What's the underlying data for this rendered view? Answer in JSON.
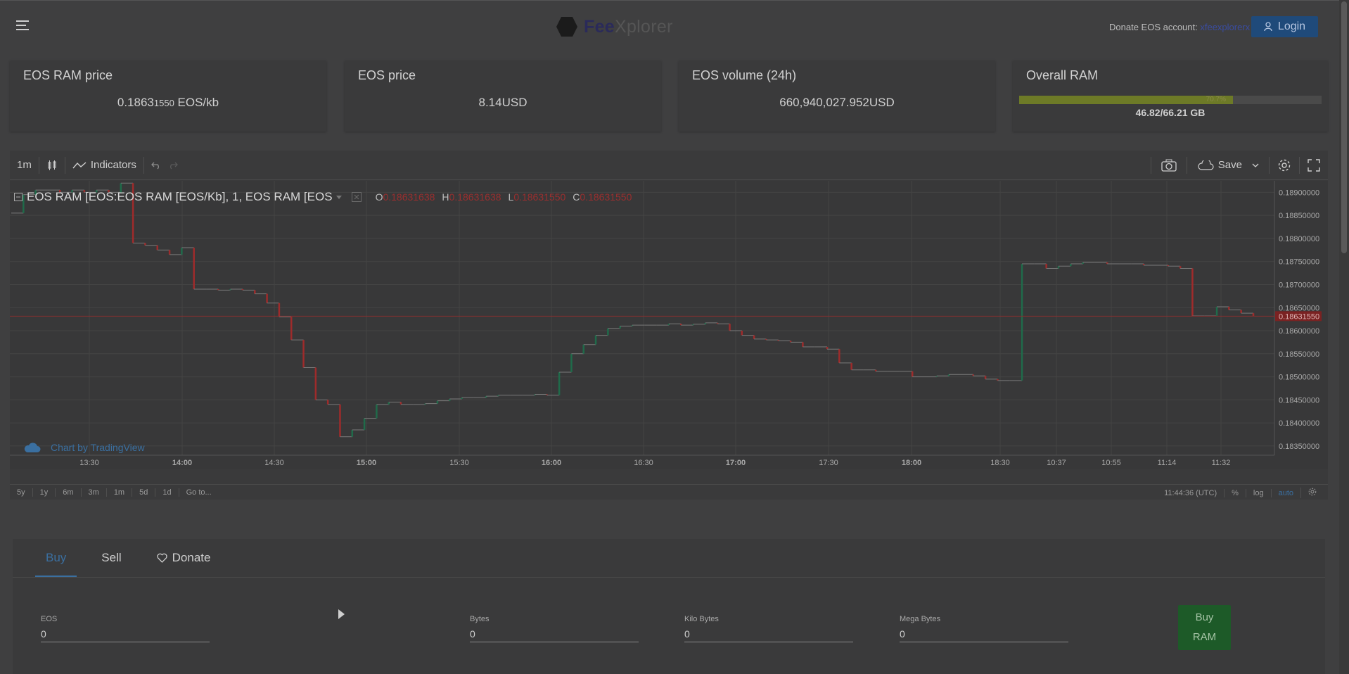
{
  "header": {
    "logo_fee": "Fee",
    "logo_xplorer": "Xplorer",
    "donate_prefix": "Donate EOS account: ",
    "donate_account": "xfeexplorerx",
    "login_label": "Login"
  },
  "stats": {
    "ram_price": {
      "title": "EOS RAM price",
      "value_main": "0.1863",
      "value_small": "1550",
      "unit": " EOS/kb"
    },
    "eos_price": {
      "title": "EOS price",
      "value": "8.14USD"
    },
    "eos_volume": {
      "title": "EOS volume (24h)",
      "value": "660,940,027.952USD"
    },
    "overall_ram": {
      "title": "Overall RAM",
      "percent_label": "70.7%",
      "fill_percent": 70.7,
      "value": "46.82/66.21 GB"
    }
  },
  "chart_toolbar": {
    "interval": "1m",
    "indicators": "Indicators",
    "save": "Save"
  },
  "chart_legend": {
    "symbol": "EOS RAM [EOS:EOS RAM [EOS/Kb], 1, EOS RAM [EOS",
    "o_label": "O",
    "o_value": "0.18631638",
    "h_label": "H",
    "h_value": "0.18631638",
    "l_label": "L",
    "l_value": "0.18631550",
    "c_label": "C",
    "c_value": "0.18631550"
  },
  "tradingview_credit": "Chart by TradingView",
  "range_bar": {
    "ranges": [
      "5y",
      "1y",
      "6m",
      "3m",
      "1m",
      "5d",
      "1d",
      "Go to..."
    ],
    "time": "11:44:36 (UTC)",
    "percent": "%",
    "log": "log",
    "auto": "auto"
  },
  "chart_data": {
    "type": "line",
    "x_ticks": [
      "13:30",
      "14:00",
      "14:30",
      "15:00",
      "15:30",
      "16:00",
      "16:30",
      "17:00",
      "17:30",
      "18:00",
      "18:30",
      "10:37",
      "10:55",
      "11:14",
      "11:32"
    ],
    "bold_ticks": [
      "14:00",
      "15:00",
      "16:00",
      "17:00",
      "18:00"
    ],
    "y_ticks": [
      "0.18900000",
      "0.18850000",
      "0.18800000",
      "0.18750000",
      "0.18700000",
      "0.18650000",
      "0.18600000",
      "0.18550000",
      "0.18500000",
      "0.18450000",
      "0.18400000",
      "0.18350000"
    ],
    "ylim": [
      0.1833,
      0.18925
    ],
    "last_price_label": "0.18631550",
    "last_price": 0.1863155,
    "series": [
      {
        "values": [
          0.18855,
          0.18895,
          0.18905,
          0.18905,
          0.189,
          0.18905,
          0.189,
          0.18905,
          0.189,
          0.1892,
          0.1879,
          0.18785,
          0.18775,
          0.18765,
          0.1878,
          0.1869,
          0.1869,
          0.18688,
          0.1869,
          0.18688,
          0.1868,
          0.1866,
          0.1863,
          0.1858,
          0.1852,
          0.1845,
          0.1844,
          0.1837,
          0.18385,
          0.1841,
          0.1844,
          0.18445,
          0.1844,
          0.1844,
          0.18442,
          0.18448,
          0.18452,
          0.18455,
          0.18455,
          0.18458,
          0.1846,
          0.1846,
          0.1846,
          0.18462,
          0.1846,
          0.1851,
          0.1855,
          0.1857,
          0.1859,
          0.18605,
          0.1861,
          0.18612,
          0.18612,
          0.18612,
          0.18615,
          0.18612,
          0.18614,
          0.18617,
          0.18615,
          0.186,
          0.1859,
          0.18582,
          0.1858,
          0.18578,
          0.18575,
          0.18565,
          0.18565,
          0.1856,
          0.1853,
          0.18515,
          0.18515,
          0.18512,
          0.18512,
          0.18512,
          0.185,
          0.185,
          0.18502,
          0.18505,
          0.18505,
          0.18502,
          0.18495,
          0.18492,
          0.18492,
          0.18745,
          0.18745,
          0.18735,
          0.1874,
          0.18745,
          0.18748,
          0.18748,
          0.18745,
          0.18745,
          0.18745,
          0.18742,
          0.18742,
          0.1874,
          0.18735,
          0.18632,
          0.18632,
          0.18652,
          0.18645,
          0.18638,
          0.18632
        ]
      }
    ]
  },
  "trade": {
    "tabs": [
      "Buy",
      "Sell",
      "Donate"
    ],
    "fields": {
      "eos": {
        "label": "EOS",
        "value": "0"
      },
      "bytes": {
        "label": "Bytes",
        "value": "0"
      },
      "kilobytes": {
        "label": "Kilo Bytes",
        "value": "0"
      },
      "megabytes": {
        "label": "Mega Bytes",
        "value": "0"
      }
    },
    "buy_line1": "Buy",
    "buy_line2": "RAM"
  },
  "colors": {
    "up": "#1f6b4a",
    "down": "#9e2b2b",
    "price_line": "#8a2f2f",
    "accent": "#3a6fa0"
  }
}
